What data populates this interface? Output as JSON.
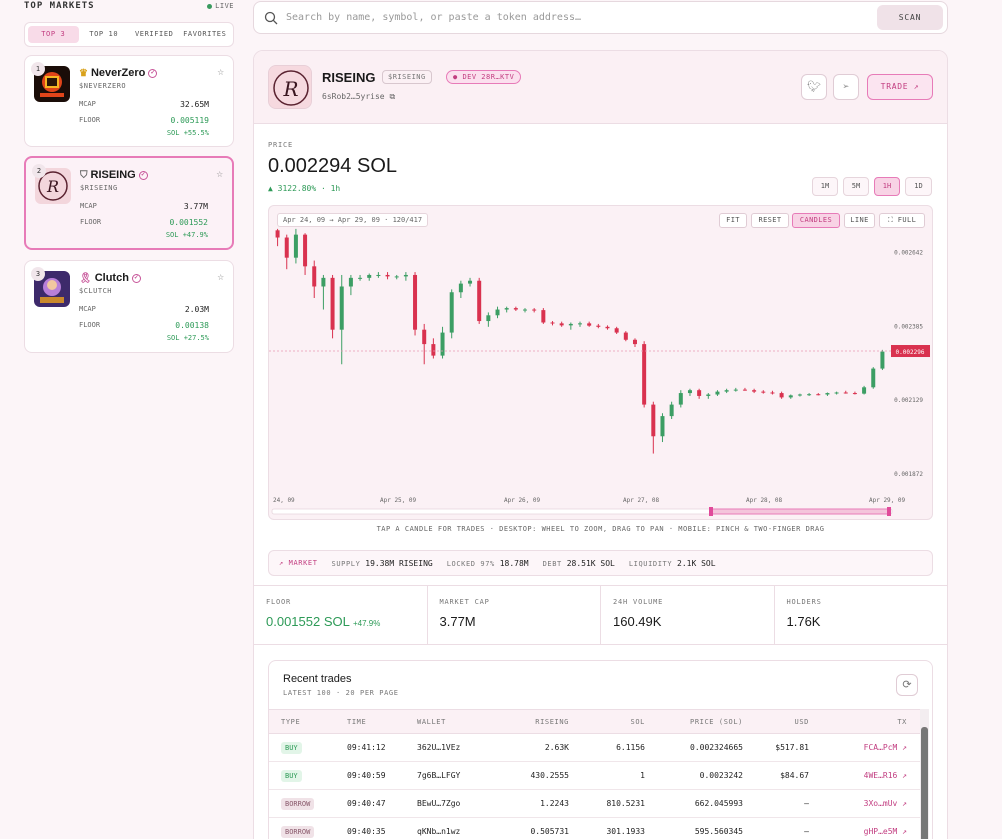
{
  "sidebar": {
    "title": "TOP MARKETS",
    "live": "LIVE",
    "tabs": [
      "TOP 3",
      "TOP 10",
      "VERIFIED",
      "FAVORITES"
    ],
    "markets": [
      {
        "rank": "1",
        "name": "NeverZero",
        "symbol": "$NEVERZERO",
        "mcap_label": "MCAP",
        "mcap": "32.65M",
        "floor_label": "FLOOR",
        "floor": "0.005119",
        "change": "SOL +55.5%"
      },
      {
        "rank": "2",
        "name": "RISEING",
        "symbol": "$RISEING",
        "mcap_label": "MCAP",
        "mcap": "3.77M",
        "floor_label": "FLOOR",
        "floor": "0.001552",
        "change": "SOL +47.9%"
      },
      {
        "rank": "3",
        "name": "Clutch",
        "symbol": "$CLUTCH",
        "mcap_label": "MCAP",
        "mcap": "2.03M",
        "floor_label": "FLOOR",
        "floor": "0.00138",
        "change": "SOL +27.5%"
      }
    ]
  },
  "search": {
    "placeholder": "Search by name, symbol, or paste a token address…",
    "button": "SCAN"
  },
  "token": {
    "name": "RISEING",
    "symbol": "$RISEING",
    "dev": "DEV 28R…KTV",
    "address": "6sRob2…5yrise",
    "trade": "TRADE"
  },
  "price": {
    "label": "PRICE",
    "value": "0.002294 SOL",
    "change": "▲ 3122.80% · 1h",
    "timeframes": [
      "1M",
      "5M",
      "1H",
      "1D"
    ],
    "active_tf": "1H"
  },
  "chart": {
    "range": "Apr 24, 09 → Apr 29, 09 · 120/417",
    "buttons": [
      "FIT",
      "RESET",
      "CANDLES",
      "LINE",
      "⛶ FULL"
    ],
    "hint": "TAP A CANDLE FOR TRADES · DESKTOP: WHEEL TO ZOOM, DRAG TO PAN · MOBILE: PINCH & TWO-FINGER DRAG"
  },
  "chart_data": {
    "type": "candlestick",
    "y_ticks": [
      "0.002642",
      "0.002385",
      "0.002129",
      "0.001872"
    ],
    "x_ticks": [
      "24, 09",
      "Apr 25, 09",
      "Apr 26, 09",
      "Apr 27, 08",
      "Apr 28, 08",
      "Apr 29, 09"
    ],
    "current_price_label": "0.002296",
    "ylim": [
      0.00181,
      0.00273
    ],
    "candles": [
      [
        0.002715,
        0.00272,
        0.00266,
        0.00269
      ],
      [
        0.00269,
        0.0027,
        0.00258,
        0.00262
      ],
      [
        0.00262,
        0.00272,
        0.0026,
        0.0027
      ],
      [
        0.0027,
        0.002705,
        0.00256,
        0.00259
      ],
      [
        0.00259,
        0.00261,
        0.00248,
        0.00252
      ],
      [
        0.00252,
        0.00256,
        0.00244,
        0.00255
      ],
      [
        0.00255,
        0.00256,
        0.00234,
        0.00237
      ],
      [
        0.00237,
        0.00256,
        0.00225,
        0.00252
      ],
      [
        0.00252,
        0.00256,
        0.00249,
        0.00255
      ],
      [
        0.00255,
        0.00256,
        0.00254,
        0.00255
      ],
      [
        0.00255,
        0.002565,
        0.00254,
        0.00256
      ],
      [
        0.00256,
        0.00257,
        0.00255,
        0.00256
      ],
      [
        0.00256,
        0.00257,
        0.002545,
        0.002555
      ],
      [
        0.002555,
        0.00256,
        0.002545,
        0.002555
      ],
      [
        0.002555,
        0.00257,
        0.00254,
        0.00256
      ],
      [
        0.00256,
        0.00257,
        0.00235,
        0.00237
      ],
      [
        0.00237,
        0.00239,
        0.00225,
        0.00232
      ],
      [
        0.00232,
        0.00234,
        0.00227,
        0.00228
      ],
      [
        0.00228,
        0.00238,
        0.00227,
        0.00236
      ],
      [
        0.00236,
        0.00251,
        0.00234,
        0.0025
      ],
      [
        0.0025,
        0.00254,
        0.00248,
        0.00253
      ],
      [
        0.00253,
        0.00255,
        0.00252,
        0.00254
      ],
      [
        0.00254,
        0.00255,
        0.00239,
        0.0024
      ],
      [
        0.0024,
        0.00243,
        0.00238,
        0.00242
      ],
      [
        0.00242,
        0.00245,
        0.00241,
        0.00244
      ],
      [
        0.00244,
        0.00245,
        0.00243,
        0.002445
      ],
      [
        0.002445,
        0.00245,
        0.002435,
        0.00244
      ],
      [
        0.00244,
        0.002445,
        0.00243,
        0.00244
      ],
      [
        0.00244,
        0.002445,
        0.00243,
        0.002438
      ],
      [
        0.002438,
        0.002445,
        0.00239,
        0.002395
      ],
      [
        0.002395,
        0.0024,
        0.002385,
        0.002392
      ],
      [
        0.002392,
        0.002398,
        0.00238,
        0.002385
      ],
      [
        0.002385,
        0.002395,
        0.00237,
        0.00239
      ],
      [
        0.00239,
        0.002398,
        0.00238,
        0.002392
      ],
      [
        0.002392,
        0.002398,
        0.00238,
        0.002384
      ],
      [
        0.002384,
        0.00239,
        0.002375,
        0.00238
      ],
      [
        0.00238,
        0.002385,
        0.00237,
        0.002375
      ],
      [
        0.002375,
        0.00238,
        0.002355,
        0.00236
      ],
      [
        0.00236,
        0.002365,
        0.00233,
        0.002335
      ],
      [
        0.002335,
        0.00234,
        0.00231,
        0.00232
      ],
      [
        0.00232,
        0.00233,
        0.0021,
        0.00211
      ],
      [
        0.00211,
        0.00212,
        0.00194,
        0.002
      ],
      [
        0.002,
        0.00208,
        0.00198,
        0.00207
      ],
      [
        0.00207,
        0.00212,
        0.00206,
        0.00211
      ],
      [
        0.00211,
        0.00216,
        0.0021,
        0.00215
      ],
      [
        0.00215,
        0.002165,
        0.00214,
        0.00216
      ],
      [
        0.00216,
        0.002165,
        0.00213,
        0.00214
      ],
      [
        0.00214,
        0.00215,
        0.00213,
        0.002145
      ],
      [
        0.002145,
        0.00216,
        0.00214,
        0.002155
      ],
      [
        0.002155,
        0.002165,
        0.00215,
        0.00216
      ],
      [
        0.00216,
        0.002168,
        0.002155,
        0.002162
      ],
      [
        0.002162,
        0.002168,
        0.002158,
        0.00216
      ],
      [
        0.00216,
        0.002165,
        0.00215,
        0.002155
      ],
      [
        0.002155,
        0.00216,
        0.002148,
        0.002152
      ],
      [
        0.002152,
        0.002158,
        0.002145,
        0.00215
      ],
      [
        0.00215,
        0.002155,
        0.00213,
        0.002135
      ],
      [
        0.002135,
        0.002145,
        0.00213,
        0.002142
      ],
      [
        0.002142,
        0.002148,
        0.002138,
        0.002145
      ],
      [
        0.002145,
        0.00215,
        0.00214,
        0.002146
      ],
      [
        0.002146,
        0.00215,
        0.002142,
        0.002145
      ],
      [
        0.002145,
        0.002152,
        0.00214,
        0.00215
      ],
      [
        0.00215,
        0.002155,
        0.002145,
        0.002152
      ],
      [
        0.002152,
        0.002158,
        0.002148,
        0.00215
      ],
      [
        0.00215,
        0.002155,
        0.002145,
        0.002148
      ],
      [
        0.002148,
        0.002175,
        0.002145,
        0.00217
      ],
      [
        0.00217,
        0.00224,
        0.002165,
        0.002235
      ],
      [
        0.002235,
        0.0023,
        0.00223,
        0.002294
      ]
    ]
  },
  "market": {
    "label": "MARKET",
    "supply_label": "SUPPLY",
    "supply": "19.38M RISEING",
    "locked_label": "LOCKED 97%",
    "locked": "18.78M",
    "debt_label": "DEBT",
    "debt": "28.51K SOL",
    "liq_label": "LIQUIDITY",
    "liq": "2.1K SOL"
  },
  "stats": {
    "floor_label": "FLOOR",
    "floor": "0.001552 SOL",
    "floor_change": "+47.9%",
    "mcap_label": "MARKET CAP",
    "mcap": "3.77M",
    "vol_label": "24H VOLUME",
    "vol": "160.49K",
    "holders_label": "HOLDERS",
    "holders": "1.76K"
  },
  "trades": {
    "title": "Recent trades",
    "subtitle": "LATEST 100 · 20 PER PAGE",
    "columns": [
      "TYPE",
      "TIME",
      "WALLET",
      "RISEING",
      "SOL",
      "PRICE (SOL)",
      "USD",
      "TX"
    ],
    "rows": [
      {
        "type": "BUY",
        "time": "09:41:12",
        "wallet": "362U…1VEz",
        "amount": "2.63K",
        "sol": "6.1156",
        "price": "0.002324665",
        "usd": "$517.81",
        "tx": "FCA…PcM"
      },
      {
        "type": "BUY",
        "time": "09:40:59",
        "wallet": "7g6B…LFGY",
        "amount": "430.2555",
        "sol": "1",
        "price": "0.0023242",
        "usd": "$84.67",
        "tx": "4WE…R16"
      },
      {
        "type": "BORROW",
        "time": "09:40:47",
        "wallet": "BEwU…7Zgo",
        "amount": "1.2243",
        "sol": "810.5231",
        "price": "662.045993",
        "usd": "—",
        "tx": "3Xo…mUv"
      },
      {
        "type": "BORROW",
        "time": "09:40:35",
        "wallet": "qKNb…n1wz",
        "amount": "0.505731",
        "sol": "301.1933",
        "price": "595.560345",
        "usd": "—",
        "tx": "gHP…e5M"
      }
    ]
  },
  "colors": {
    "accent": "#e77bb8",
    "up": "#3c9e64",
    "down": "#d9324f"
  }
}
